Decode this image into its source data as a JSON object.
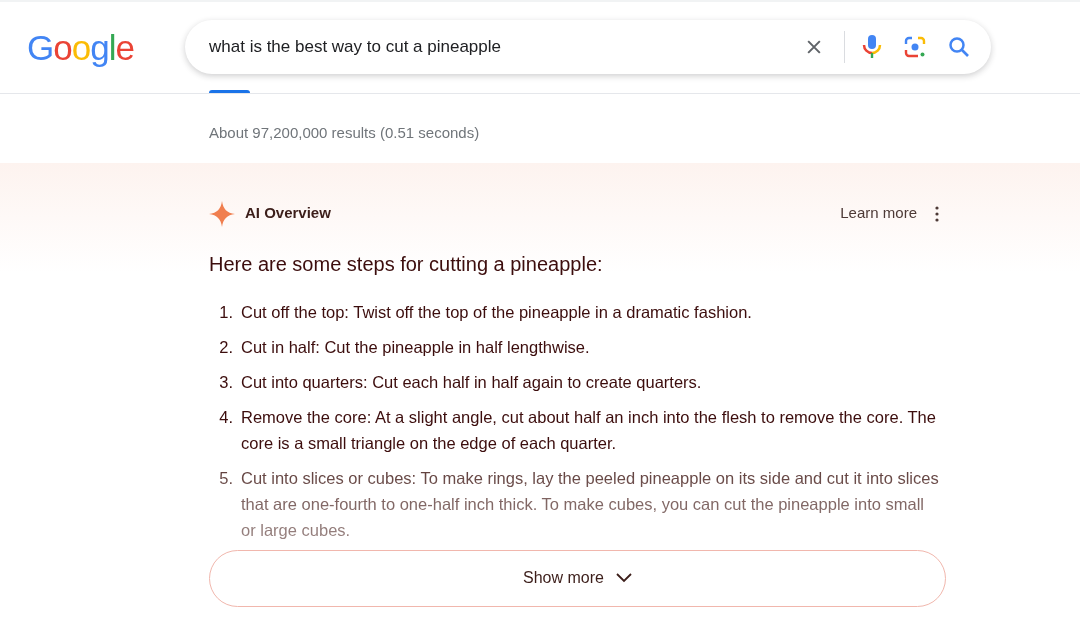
{
  "logo": "Google",
  "search": {
    "value": "what is the best way to cut a pineapple"
  },
  "results_count": "About 97,200,000 results (0.51 seconds)",
  "ai_overview": {
    "title": "AI Overview",
    "learn_more": "Learn more",
    "heading": "Here are some steps for cutting a pineapple:",
    "steps": [
      {
        "number": "1.",
        "text": "Cut off the top: Twist off the top of the pineapple in a dramatic fashion.",
        "faded": false
      },
      {
        "number": "2.",
        "text": "Cut in half: Cut the pineapple in half lengthwise.",
        "faded": false
      },
      {
        "number": "3.",
        "text": "Cut into quarters: Cut each half in half again to create quarters.",
        "faded": false
      },
      {
        "number": "4.",
        "text": "Remove the core: At a slight angle, cut about half an inch into the flesh to remove the core. The core is a small triangle on the edge of each quarter.",
        "faded": false
      },
      {
        "number": "5.",
        "text": "Cut into slices or cubes: To make rings, lay the peeled pineapple on its side and cut it into slices that are one-fourth to one-half inch thick. To make cubes, you can cut the pineapple into small or large cubes.",
        "faded": true
      }
    ],
    "show_more": "Show more"
  }
}
